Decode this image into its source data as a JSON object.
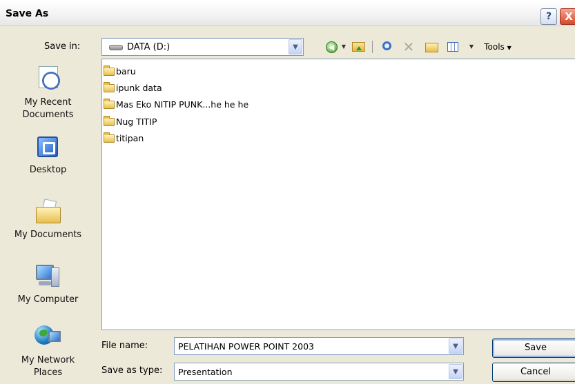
{
  "window": {
    "title": "Save As",
    "help_label": "?",
    "close_label": "X"
  },
  "save_in": {
    "label": "Save in:",
    "value": "DATA (D:)"
  },
  "toolbar": {
    "tools_label": "Tools"
  },
  "places": [
    {
      "label_line1": "My Recent",
      "label_line2": "Documents",
      "icon": "recent-documents-icon"
    },
    {
      "label_line1": "Desktop",
      "label_line2": "",
      "icon": "desktop-icon"
    },
    {
      "label_line1": "My Documents",
      "label_line2": "",
      "icon": "my-documents-icon"
    },
    {
      "label_line1": "My Computer",
      "label_line2": "",
      "icon": "my-computer-icon"
    },
    {
      "label_line1": "My Network",
      "label_line2": "Places",
      "icon": "network-places-icon"
    }
  ],
  "files": [
    {
      "name": "baru"
    },
    {
      "name": "ipunk data"
    },
    {
      "name": "Mas Eko NITIP PUNK...he he he"
    },
    {
      "name": "Nug TITIP"
    },
    {
      "name": "titipan"
    }
  ],
  "file_name": {
    "label": "File name:",
    "value": "PELATIHAN POWER POINT 2003"
  },
  "save_as_type": {
    "label": "Save as type:",
    "value": "Presentation"
  },
  "buttons": {
    "save": "Save",
    "cancel": "Cancel"
  }
}
